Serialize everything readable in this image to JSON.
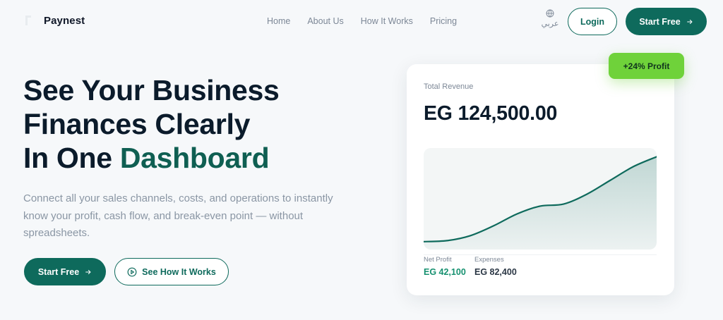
{
  "brand": {
    "name": "Paynest"
  },
  "nav": {
    "links": [
      "Home",
      "About Us",
      "How It Works",
      "Pricing"
    ],
    "language_label": "عربي",
    "login_label": "Login",
    "start_label": "Start Free"
  },
  "hero": {
    "title_line1": "See Your Business",
    "title_line2": "Finances Clearly",
    "title_line3_prefix": "In One",
    "title_line3_accent": "Dashboard",
    "description": "Connect all your sales channels, costs, and operations to instantly know your profit, cash flow, and break-even point — without spreadsheets.",
    "cta_primary": "Start Free",
    "cta_secondary": "See How It Works"
  },
  "card": {
    "label": "Total Revenue",
    "value": "EG 124,500.00",
    "badge": "+24% Profit",
    "stats": [
      {
        "label": "Net Profit",
        "value": "EG 42,100"
      },
      {
        "label": "Expenses",
        "value": "EG 82,400"
      }
    ],
    "chart_data": {
      "type": "area",
      "x": [
        0,
        1,
        2,
        3,
        4,
        5,
        6,
        7,
        8,
        9,
        10
      ],
      "values": [
        8,
        9,
        14,
        24,
        36,
        44,
        46,
        56,
        70,
        84,
        94
      ],
      "ylim": [
        0,
        100
      ]
    }
  },
  "colors": {
    "primary": "#0e6a5c",
    "accent_text": "#0f5f52",
    "badge": "#6fd23a",
    "profit": "#15906f"
  },
  "icons": {
    "globe": "globe-icon",
    "arrow": "arrow-right-icon",
    "play": "play-circle-icon"
  }
}
